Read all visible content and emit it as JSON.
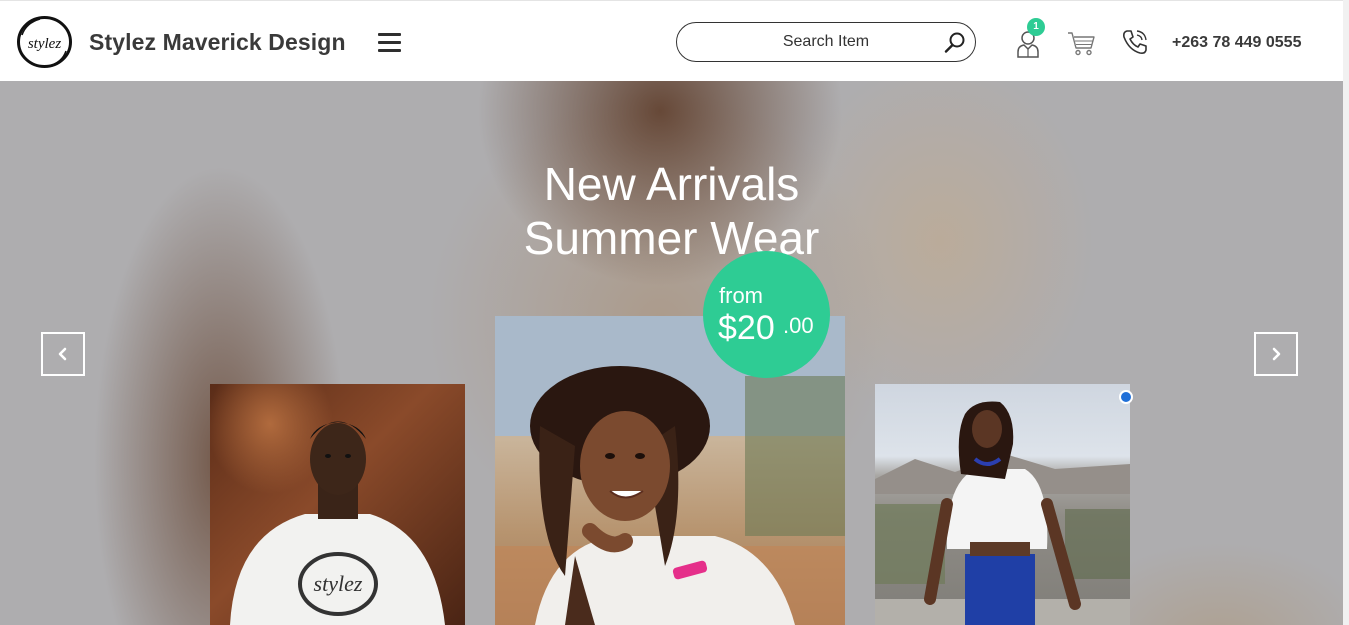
{
  "header": {
    "brand": "Stylez Maverick Design",
    "logo_text": "stylez",
    "search": {
      "placeholder": "Search Item"
    },
    "user_badge_count": "1",
    "phone": "+263 78 449 0555",
    "icons": [
      "logo",
      "menu-icon",
      "search-icon",
      "user-icon",
      "cart-icon",
      "phone-icon"
    ]
  },
  "hero": {
    "title_line1": "New Arrivals",
    "title_line2": "Summer Wear",
    "price": {
      "from": "from",
      "amount": "$20",
      "cents": ".00"
    },
    "nav": {
      "prev_icon": "chevron-left-icon",
      "next_icon": "chevron-right-icon"
    },
    "slides": [
      {
        "name": "model-man-stylez-tee"
      },
      {
        "name": "model-woman-braids"
      },
      {
        "name": "model-woman-crop-top"
      }
    ]
  },
  "colors": {
    "accent": "#2ecc94",
    "text": "#3a3a3a",
    "hero_overlay": "#aeadaf"
  }
}
